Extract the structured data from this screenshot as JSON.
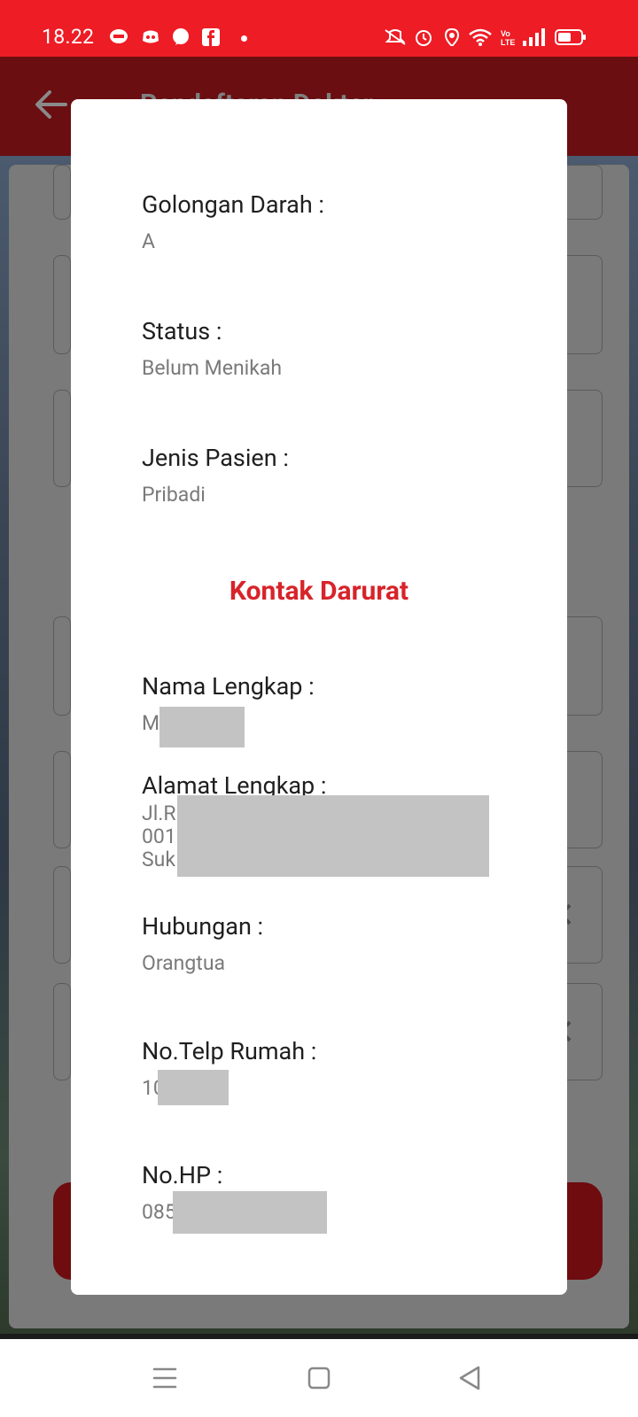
{
  "status_bar": {
    "time": "18.22",
    "left_icons": [
      "line-icon",
      "discord-icon",
      "messenger-icon",
      "facebook-icon",
      "dot-icon"
    ],
    "right_icons": [
      "mute-icon",
      "alarm-icon",
      "location-icon",
      "wifi-icon",
      "volte-icon",
      "signal-icon",
      "battery-icon"
    ],
    "background_color": "#ee1c25"
  },
  "app_bar": {
    "title": "Pendaftaran Dokter",
    "back_icon": "arrow-left-icon"
  },
  "dialog": {
    "patient_fields": [
      {
        "label": "Golongan Darah :",
        "value": "A"
      },
      {
        "label": "Status :",
        "value": "Belum Menikah"
      },
      {
        "label": "Jenis Pasien :",
        "value": "Pribadi"
      }
    ],
    "emergency_section_title": "Kontak Darurat",
    "emergency_fields": {
      "nama": {
        "label": "Nama Lengkap :",
        "value": "M"
      },
      "alamat": {
        "label": "Alamat Lengkap :",
        "lines": [
          "Jl.R",
          "001",
          "Suk"
        ]
      },
      "hubungan": {
        "label": "Hubungan :",
        "value": "Orangtua"
      },
      "telp": {
        "label": "No.Telp Rumah :",
        "value": "10"
      },
      "hp": {
        "label": "No.HP :",
        "value": "085"
      }
    },
    "accent_color": "#d8232a"
  },
  "nav_bar": {
    "buttons": [
      "menu-icon",
      "home-icon",
      "back-icon"
    ]
  }
}
